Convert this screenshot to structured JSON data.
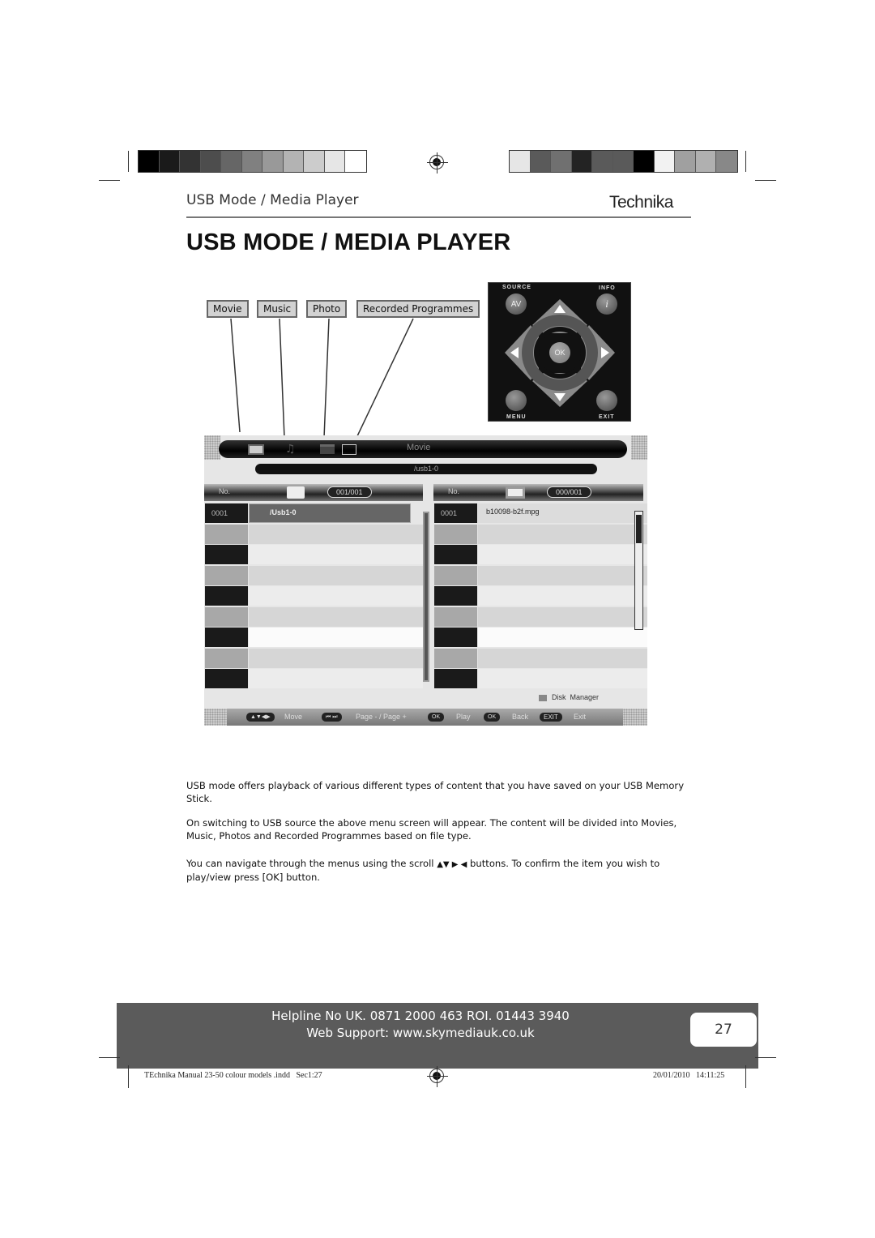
{
  "header": {
    "section_title": "USB Mode / Media Player",
    "brand": "Technika"
  },
  "page_title": "USB MODE / MEDIA PLAYER",
  "color_bars": {
    "left": [
      "#000000",
      "#1a1a1a",
      "#333333",
      "#4d4d4d",
      "#666666",
      "#808080",
      "#999999",
      "#b3b3b3",
      "#cccccc",
      "#e6e6e6",
      "#ffffff"
    ],
    "right": [
      "#e6e6e6",
      "#5a5a5a",
      "#707070",
      "#232323",
      "#5a5a5a",
      "#5a5a5a",
      "#000000",
      "#f2f2f2",
      "#a0a0a0",
      "#b0b0b0",
      "#888888"
    ]
  },
  "categories": [
    "Movie",
    "Music",
    "Photo",
    "Recorded Programmes"
  ],
  "remote": {
    "source_label": "SOURCE",
    "info_label": "INFO",
    "menu_label": "MENU",
    "exit_label": "EXIT",
    "av_label": "AV",
    "info_glyph": "i",
    "ok_label": "OK"
  },
  "media_screen": {
    "mode": "Movie",
    "path": "/usb1-0",
    "left_panel": {
      "no_label": "No.",
      "count": "001/001",
      "rows": [
        {
          "num": "0001",
          "name": "/Usb1-0"
        }
      ]
    },
    "right_panel": {
      "no_label": "No.",
      "count": "000/001",
      "rows": [
        {
          "num": "0001",
          "name": "b10098-b2f.mpg"
        }
      ]
    },
    "disk_manager": "Disk  Manager",
    "help_bar": {
      "move_keys": "▲▼◀▶",
      "move": "Move",
      "page_keys": "⏮ ⏭",
      "page": "Page - / Page +",
      "ok1": "OK",
      "play": "Play",
      "ok2": "OK",
      "back": "Back",
      "exit_key": "EXIT",
      "exit": "Exit"
    }
  },
  "body": {
    "p1": "USB mode offers playback of various different types of content that you have saved on your USB Memory Stick.",
    "p2": "On switching to USB source the above menu screen will appear. The content will be divided into Movies, Music, Photos and Recorded Programmes based on file type.",
    "p3_before": "You can navigate through the menus using the scroll ",
    "p3_arrows": "▲▼ ▶ ◀",
    "p3_after": "buttons. To confirm the item you wish to play/view press [OK] button."
  },
  "footer": {
    "helpline": "Helpline No UK. 0871 2000 463  ROI. 01443 3940",
    "web_support": "Web Support: www.skymediauk.co.uk",
    "page_number": "27"
  },
  "slug": {
    "file": "TEchnika Manual 23-50 colour models .indd   Sec1:27",
    "datetime": "20/01/2010   14:11:25"
  }
}
